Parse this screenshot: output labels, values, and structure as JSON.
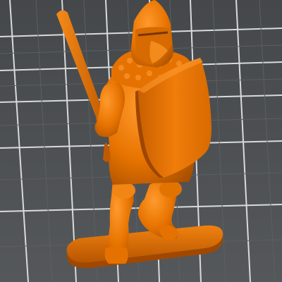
{
  "viewport": {
    "background_color": "#4b4e51",
    "grid_line_color": "#d9dadb",
    "object_color": "#e87400",
    "object_shadow_color": "#a84e00",
    "object_highlight_color": "#ff9a2e"
  },
  "scene": {
    "object": "knight-miniature-model",
    "parts": [
      "helmet",
      "visor",
      "mail-collar",
      "sword",
      "shield",
      "body",
      "legs",
      "base"
    ]
  }
}
